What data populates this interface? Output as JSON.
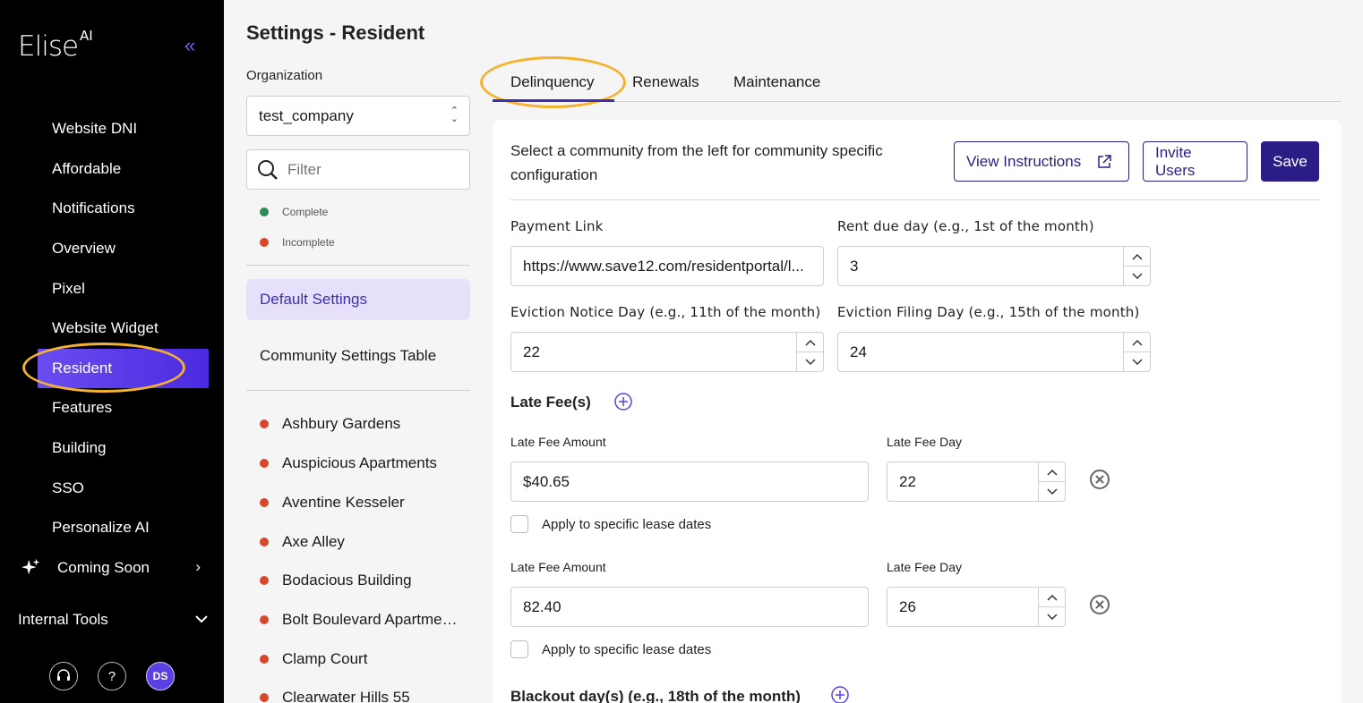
{
  "app": {
    "logo": "Elise",
    "logo_suffix": "AI",
    "page_title": "Settings - Resident"
  },
  "sidebar": {
    "items": [
      {
        "label": "Website DNI"
      },
      {
        "label": "Affordable"
      },
      {
        "label": "Notifications"
      },
      {
        "label": "Overview"
      },
      {
        "label": "Pixel"
      },
      {
        "label": "Website Widget"
      },
      {
        "label": "Resident",
        "active": true
      },
      {
        "label": "Features"
      },
      {
        "label": "Building"
      },
      {
        "label": "SSO"
      },
      {
        "label": "Personalize AI"
      }
    ],
    "coming_soon": "Coming Soon",
    "internal_tools": "Internal Tools",
    "help_icon_text": "?",
    "avatar_initials": "DS"
  },
  "left_panel": {
    "org_label": "Organization",
    "org_value": "test_company",
    "filter_placeholder": "Filter",
    "legend": [
      {
        "label": "Complete",
        "color": "#2e8b57"
      },
      {
        "label": "Incomplete",
        "color": "#d9472b"
      }
    ],
    "default_settings": "Default Settings",
    "community_settings_table": "Community Settings Table",
    "communities": [
      "Ashbury Gardens",
      "Auspicious Apartments",
      "Aventine Kesseler",
      "Axe Alley",
      "Bodacious Building",
      "Bolt Boulevard Apartme…",
      "Clamp Court",
      "Clearwater Hills 55"
    ]
  },
  "tabs": [
    {
      "label": "Delinquency",
      "active": true
    },
    {
      "label": "Renewals"
    },
    {
      "label": "Maintenance"
    }
  ],
  "form": {
    "intro": "Select a community from the left for community specific configuration",
    "view_instructions": "View Instructions",
    "invite_users": "Invite Users",
    "save": "Save",
    "payment_link_label": "Payment Link",
    "payment_link_value": "https://www.save12.com/residentportal/l...",
    "rent_due_label": "Rent due day (e.g., 1st of the month)",
    "rent_due_value": "3",
    "eviction_notice_label": "Eviction Notice Day (e.g., 11th of the month)",
    "eviction_notice_value": "22",
    "eviction_filing_label": "Eviction Filing Day (e.g., 15th of the month)",
    "eviction_filing_value": "24",
    "late_fees_heading": "Late Fee(s)",
    "late_fee_amount_label": "Late Fee Amount",
    "late_fee_day_label": "Late Fee Day",
    "apply_lease_dates": "Apply to specific lease dates",
    "late_fees": [
      {
        "amount": "$40.65",
        "day": "22"
      },
      {
        "amount": "82.40",
        "day": "26"
      }
    ],
    "blackout_heading": "Blackout day(s) (e.g., 18th of the month)"
  },
  "colors": {
    "accent": "#2a1e86",
    "highlight": "#f5b22e",
    "sidebar_active": "#5b3fe0"
  }
}
